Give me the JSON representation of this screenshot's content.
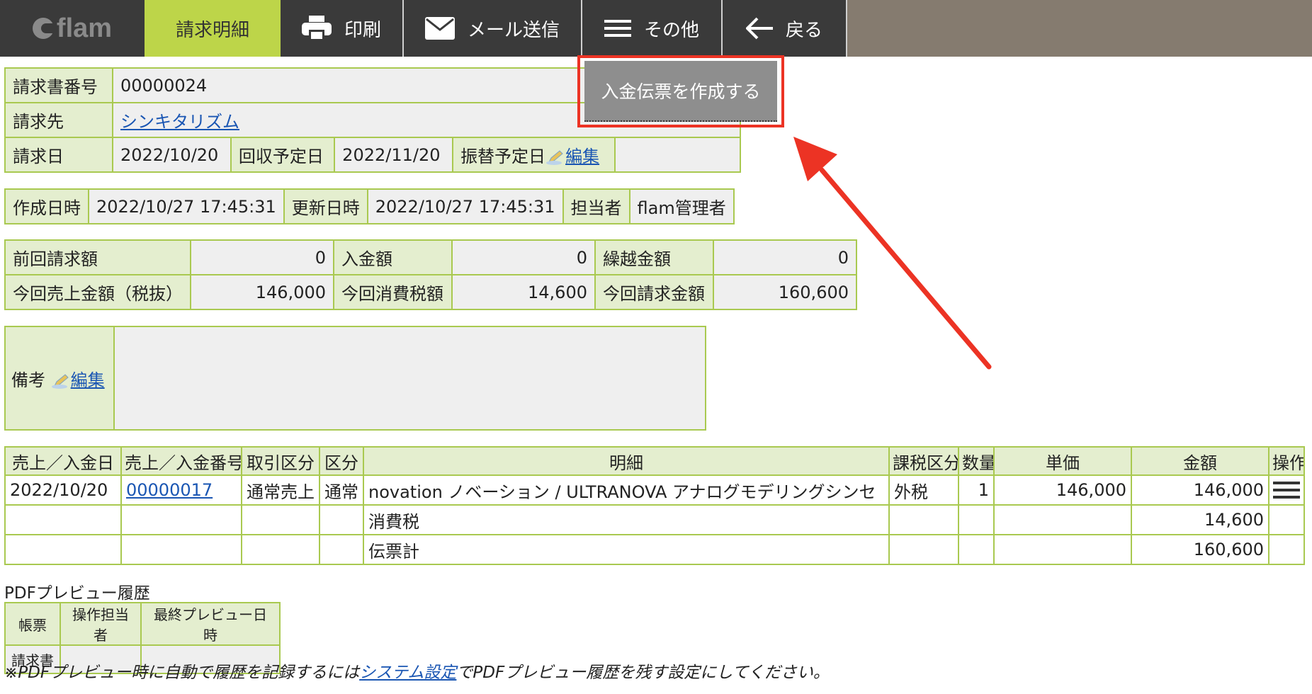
{
  "nav": {
    "logo": "flam",
    "tabs": [
      {
        "label": "請求明細",
        "active": true
      },
      {
        "label": "印刷",
        "icon": "printer-icon"
      },
      {
        "label": "メール送信",
        "icon": "mail-icon"
      },
      {
        "label": "その他",
        "icon": "menu-icon"
      },
      {
        "label": "戻る",
        "icon": "back-arrow-icon"
      }
    ],
    "dropdown_item": "入金伝票を作成する"
  },
  "invoice": {
    "number_label": "請求書番号",
    "number": "00000024",
    "client_label": "請求先",
    "client": "シンキタリズム",
    "date_label": "請求日",
    "date": "2022/10/20",
    "collect_label": "回収予定日",
    "collect_date": "2022/11/20",
    "transfer_label": "振替予定日",
    "edit_label": "編集"
  },
  "meta": {
    "created_label": "作成日時",
    "created": "2022/10/27 17:45:31",
    "updated_label": "更新日時",
    "updated": "2022/10/27 17:45:31",
    "owner_label": "担当者",
    "owner": "flam管理者"
  },
  "amounts": {
    "prev_label": "前回請求額",
    "prev": "0",
    "paid_label": "入金額",
    "paid": "0",
    "carry_label": "繰越金額",
    "carry": "0",
    "sales_label": "今回売上金額（税抜）",
    "sales": "146,000",
    "tax_label": "今回消費税額",
    "tax": "14,600",
    "total_label": "今回請求金額",
    "total": "160,600"
  },
  "remarks": {
    "label": "備考",
    "edit_label": "編集"
  },
  "items": {
    "headers": [
      "売上／入金日",
      "売上／入金番号",
      "取引区分",
      "区分",
      "明細",
      "課税区分",
      "数量",
      "単価",
      "金額",
      "操作"
    ],
    "row": {
      "date": "2022/10/20",
      "number": "00000017",
      "trade": "通常売上",
      "kind": "通常",
      "detail": "novation ノベーション / ULTRANOVA アナログモデリングシンセ",
      "tax_type": "外税",
      "qty": "1",
      "unit_price": "146,000",
      "amount": "146,000"
    },
    "tax_row": {
      "label": "消費税",
      "amount": "14,600"
    },
    "total_row": {
      "label": "伝票計",
      "amount": "160,600"
    }
  },
  "history": {
    "title": "PDFプレビュー履歴",
    "headers": [
      "帳票",
      "操作担当者",
      "最終プレビュー日時"
    ],
    "row": {
      "doc": "請求書"
    },
    "note_before": "※PDFプレビュー時に自動で履歴を記録するには",
    "note_link": "システム設定",
    "note_after": "でPDFプレビュー履歴を残す設定にしてください。"
  },
  "colors": {
    "accent": "#bdd549",
    "border": "#a9c950",
    "annotation": "#ec3324"
  }
}
